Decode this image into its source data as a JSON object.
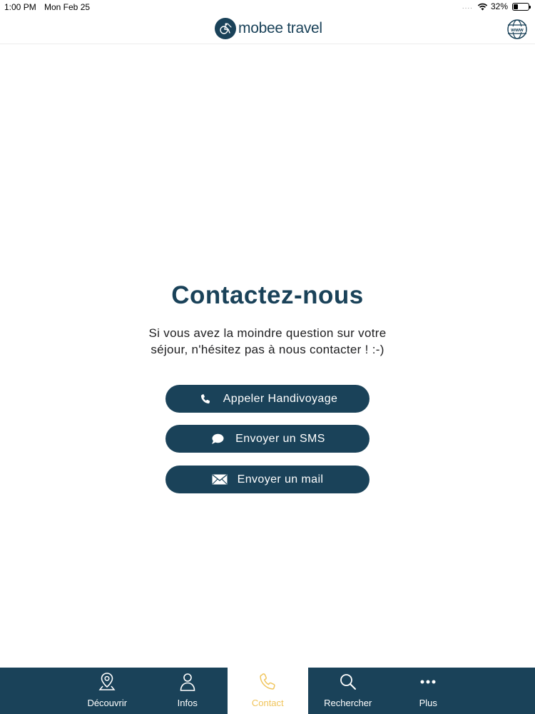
{
  "status_bar": {
    "time": "1:00 PM",
    "date": "Mon Feb 25",
    "signal_dots": "....",
    "battery_percent": "32%",
    "battery_level": 0.32
  },
  "header": {
    "brand_name": "mobee travel",
    "logo_icon": "wheelchair-icon",
    "globe_icon": "globe-www-icon",
    "globe_text": "www"
  },
  "main": {
    "title": "Contactez-nous",
    "description_line1": "Si vous avez la moindre question sur votre",
    "description_line2": "séjour, n'hésitez pas à nous contacter ! :-)",
    "buttons": [
      {
        "label": "Appeler Handivoyage",
        "icon": "phone-icon"
      },
      {
        "label": "Envoyer un SMS",
        "icon": "chat-bubble-icon"
      },
      {
        "label": "Envoyer un mail",
        "icon": "envelope-icon"
      }
    ]
  },
  "tab_bar": {
    "tabs": [
      {
        "label": "Découvrir",
        "icon": "map-pin-icon",
        "active": false
      },
      {
        "label": "Infos",
        "icon": "person-icon",
        "active": false
      },
      {
        "label": "Contact",
        "icon": "phone-icon",
        "active": true
      },
      {
        "label": "Rechercher",
        "icon": "search-icon",
        "active": false
      },
      {
        "label": "Plus",
        "icon": "more-dots-icon",
        "active": false
      }
    ]
  },
  "colors": {
    "primary": "#1a4259",
    "active_tab": "#f0c45a",
    "background": "#ffffff"
  }
}
